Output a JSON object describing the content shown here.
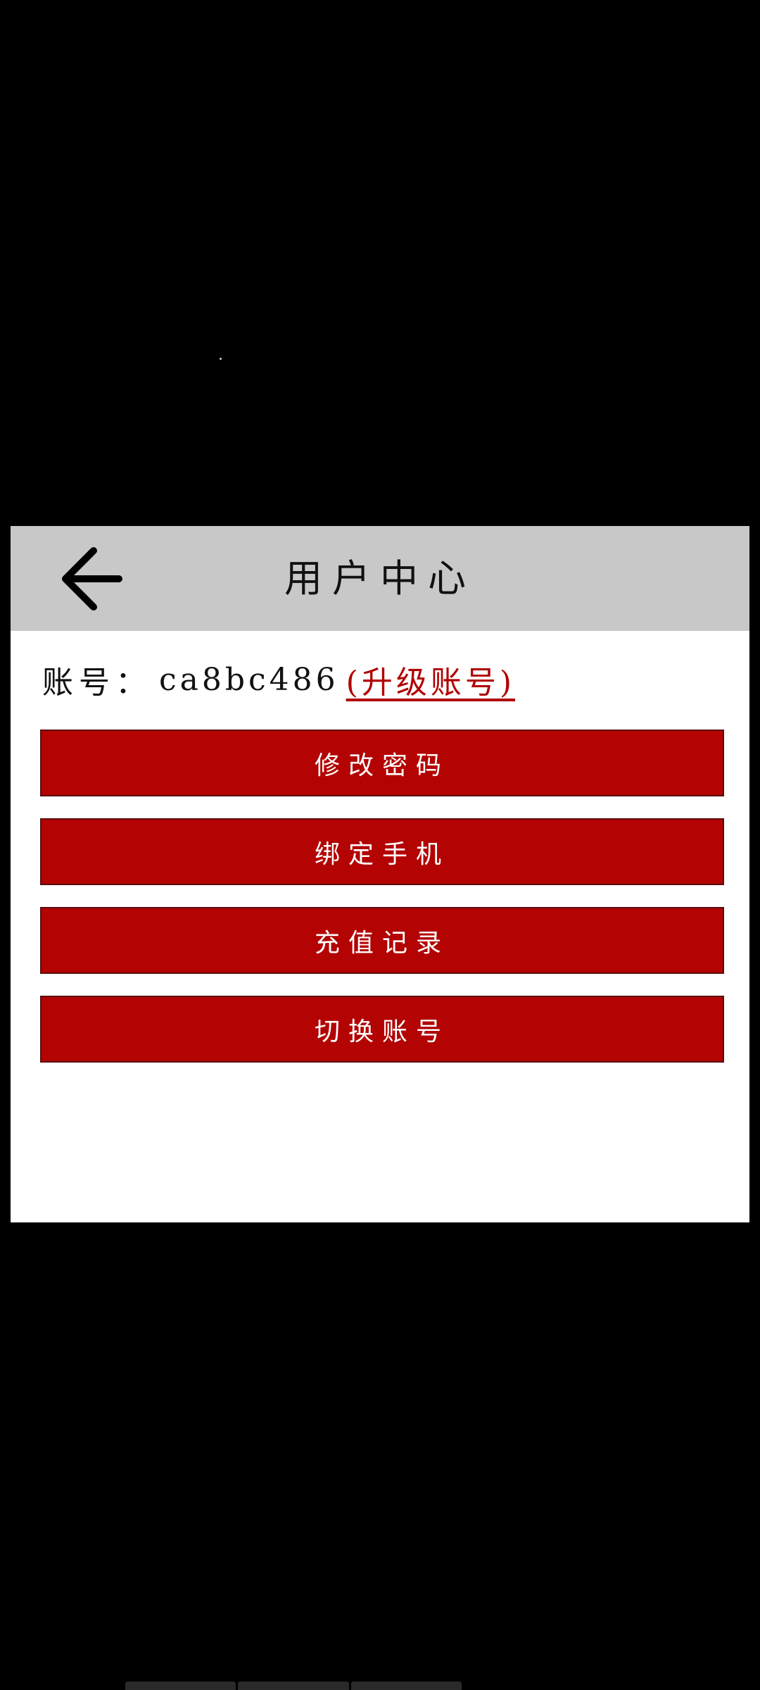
{
  "header": {
    "back_icon": "arrow-left-icon",
    "title": "用户中心"
  },
  "account": {
    "label": "账号：",
    "value": "ca8bc486",
    "upgrade_link": "(升级账号)"
  },
  "menu": {
    "items": [
      {
        "label": "修改密码"
      },
      {
        "label": "绑定手机"
      },
      {
        "label": "充值记录"
      },
      {
        "label": "切换账号"
      }
    ]
  },
  "colors": {
    "header_bg": "#c8c8c8",
    "button_bg": "#b30303",
    "link": "#b10000",
    "page_bg": "#000000"
  }
}
